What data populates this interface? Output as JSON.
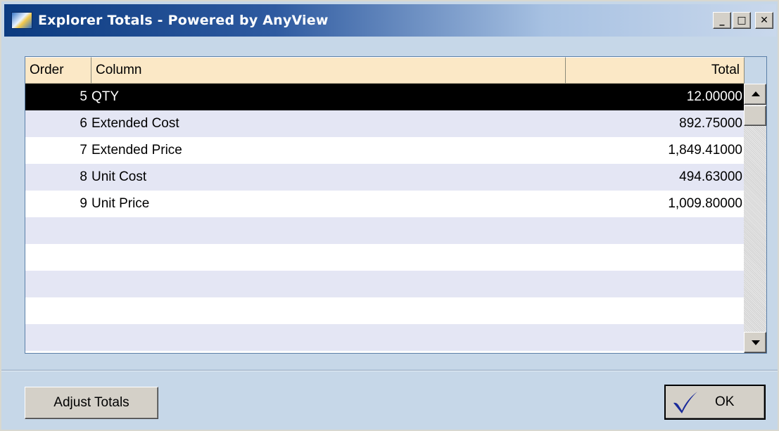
{
  "window": {
    "title": "Explorer Totals - Powered by AnyView",
    "minimize_glyph": "_",
    "maximize_glyph": "□",
    "close_glyph": "✕"
  },
  "grid": {
    "headers": {
      "order": "Order",
      "column": "Column",
      "total": "Total"
    },
    "rows": [
      {
        "order": "5",
        "column": "QTY",
        "total": "12.00000",
        "selected": true
      },
      {
        "order": "6",
        "column": "Extended Cost",
        "total": "892.75000"
      },
      {
        "order": "7",
        "column": "Extended Price",
        "total": "1,849.41000"
      },
      {
        "order": "8",
        "column": "Unit Cost",
        "total": "494.63000"
      },
      {
        "order": "9",
        "column": "Unit Price",
        "total": "1,009.80000"
      }
    ]
  },
  "buttons": {
    "adjust_totals": "Adjust Totals",
    "ok": "OK"
  },
  "colors": {
    "selected_row": "#000000",
    "alt_row": "#e4e6f4",
    "header_bg": "#fbe8c6",
    "window_bg": "#c6d7e8",
    "checkmark": "#1a2a9a"
  }
}
